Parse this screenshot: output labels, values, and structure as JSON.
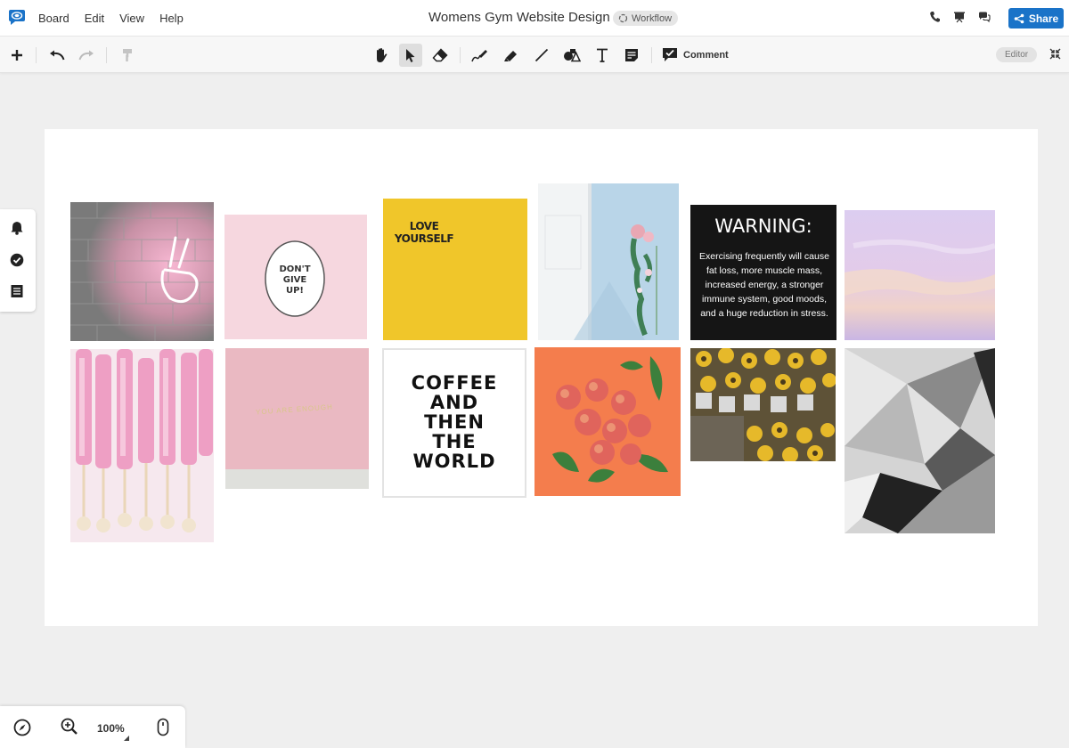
{
  "menubar": {
    "menu_items": [
      "Board",
      "Edit",
      "View",
      "Help"
    ],
    "title": "Womens Gym Website Design",
    "workflow_label": "Workflow",
    "share_label": "Share"
  },
  "toolbar": {
    "comment_label": "Comment",
    "editor_label": "Editor"
  },
  "board": {
    "tiles": {
      "love": "LOVE\nYOURSELF",
      "dont": "DON'T\nGIVE\nUP!",
      "warning_title": "WARNING:",
      "warning_body": "Exercising frequently will cause fat loss, more muscle mass, increased energy, a stronger immune system, good moods, and a huge reduction in stress.",
      "coffee": "COFFEE\nAND\nTHEN\nTHE\nWORLD",
      "enough": "YOU ARE ENOUGH"
    }
  },
  "zoom": {
    "level": "100%"
  },
  "colors": {
    "brand_blue": "#1a73c8",
    "yellow": "#f0c62a",
    "orange": "#f47d4d",
    "pink": "#f6d7df"
  }
}
